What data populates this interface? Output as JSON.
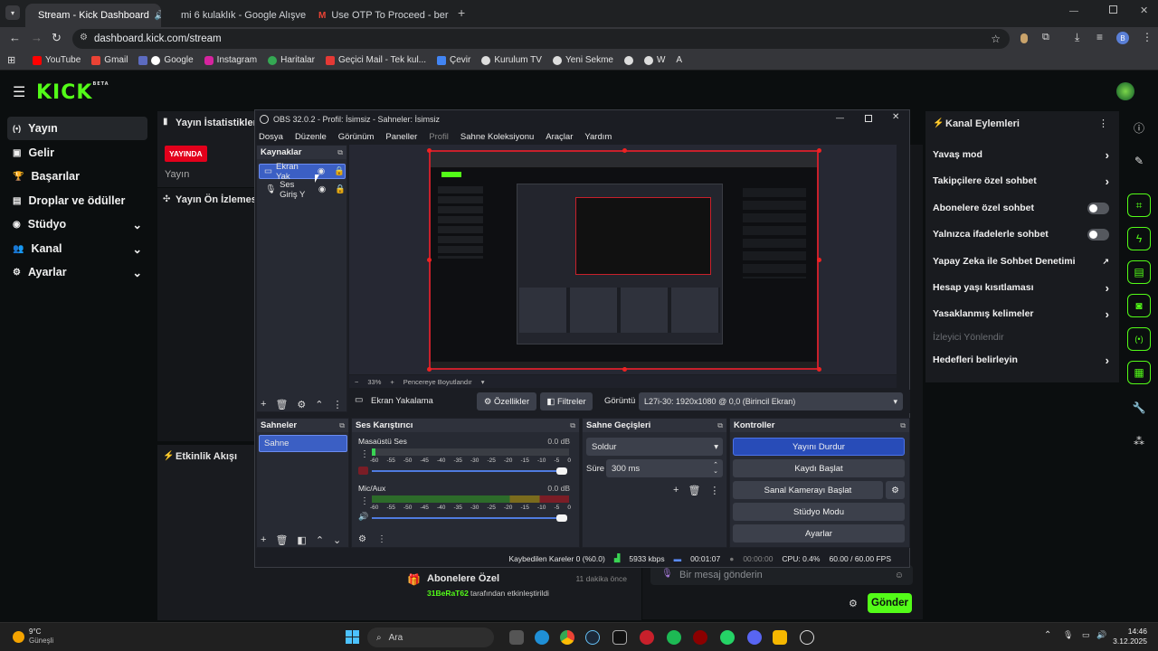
{
  "browser": {
    "tabs": [
      {
        "title": "Stream - Kick Dashboard",
        "active": true
      },
      {
        "title": "mi 6 kulaklık - Google Alışveriş",
        "active": false
      },
      {
        "title": "Use OTP To Proceed - beratery",
        "active": false
      }
    ],
    "url": "dashboard.kick.com/stream",
    "profile_initial": "B",
    "bookmarks": [
      "YouTube",
      "Gmail",
      "Google",
      "Instagram",
      "Haritalar",
      "Geçici Mail - Tek kul...",
      "Çevir",
      "Kurulum TV",
      "Yeni Sekme",
      "W",
      "A"
    ]
  },
  "kick": {
    "logo": "KICK",
    "logo_badge": "BETA",
    "sidebar": [
      {
        "label": "Yayın",
        "icon": "broadcast-icon",
        "expandable": false
      },
      {
        "label": "Gelir",
        "icon": "money-icon",
        "expandable": false
      },
      {
        "label": "Başarılar",
        "icon": "trophy-icon",
        "expandable": false
      },
      {
        "label": "Droplar ve ödüller",
        "icon": "gift-icon",
        "expandable": false
      },
      {
        "label": "Stüdyo",
        "icon": "studio-icon",
        "expandable": true
      },
      {
        "label": "Kanal",
        "icon": "channel-icon",
        "expandable": true
      },
      {
        "label": "Ayarlar",
        "icon": "gear-icon",
        "expandable": true
      }
    ],
    "stats_title": "Yayın İstatistikleri",
    "live_badge": "YAYINDA",
    "stats_sub": "Yayın",
    "preview_title": "Yayın Ön İzlemesi",
    "activity_title": "Etkinlik Akışı",
    "activity_item": {
      "title": "Abonelere Özel",
      "time": "11 dakika önce",
      "user": "31BeRaT62",
      "text": "tarafından etkinleştirildi"
    },
    "chat_placeholder": "Bir mesaj gönderin",
    "send_label": "Gönder",
    "channel_actions": {
      "title": "Kanal Eylemleri",
      "items": [
        {
          "label": "Yavaş mod",
          "control": "chevron"
        },
        {
          "label": "Takipçilere özel sohbet",
          "control": "chevron"
        },
        {
          "label": "Abonelere özel sohbet",
          "control": "toggle"
        },
        {
          "label": "Yalnızca ifadelerle sohbet",
          "control": "toggle"
        },
        {
          "label": "Yapay Zeka ile Sohbet Denetimi",
          "control": "external"
        },
        {
          "label": "Hesap yaşı kısıtlaması",
          "control": "chevron"
        },
        {
          "label": "Yasaklanmış kelimeler",
          "control": "chevron"
        },
        {
          "label": "İzleyici Yönlendir",
          "control": "disabled"
        },
        {
          "label": "Hedefleri belirleyin",
          "control": "chevron"
        }
      ]
    }
  },
  "obs": {
    "title": "OBS 32.0.2 - Profil: İsimsiz - Sahneler: İsimsiz",
    "menu": [
      "Dosya",
      "Düzenle",
      "Görünüm",
      "Paneller",
      "Profil",
      "Sahne Koleksiyonu",
      "Araçlar",
      "Yardım"
    ],
    "sources_title": "Kaynaklar",
    "sources": [
      "Ekran Yak",
      "Ses Giriş Y"
    ],
    "zoom": "33%",
    "fit_label": "Pencereye Boyutlandır",
    "source_name": "Ekran Yakalama",
    "props_label": "Özellikler",
    "filters_label": "Filtreler",
    "display_label": "Görüntü",
    "display_value": "L27i-30: 1920x1080 @ 0,0 (Birincil Ekran)",
    "scenes_title": "Sahneler",
    "scenes": [
      "Sahne"
    ],
    "mixer_title": "Ses Karıştırıcı",
    "mixer_channels": [
      {
        "name": "Masaüstü Ses",
        "db": "0.0 dB"
      },
      {
        "name": "Mic/Aux",
        "db": "0.0 dB"
      }
    ],
    "mixer_scale": [
      "-60",
      "-55",
      "-50",
      "-45",
      "-40",
      "-35",
      "-30",
      "-25",
      "-20",
      "-15",
      "-10",
      "-5",
      "0"
    ],
    "transitions_title": "Sahne Geçişleri",
    "transition": "Soldur",
    "duration_label": "Süre",
    "duration": "300 ms",
    "controls_title": "Kontroller",
    "controls": [
      "Yayını Durdur",
      "Kaydı Başlat",
      "Sanal Kamerayı Başlat",
      "Stüdyo Modu",
      "Ayarlar"
    ],
    "status": {
      "dropped": "Kaybedilen Kareler 0 (%0.0)",
      "bitrate": "5933 kbps",
      "stream_time": "00:01:07",
      "rec_time": "00:00:00",
      "cpu": "CPU: 0.4%",
      "fps": "60.00 / 60.00 FPS"
    }
  },
  "taskbar": {
    "weather_temp": "9°C",
    "weather_text": "Güneşli",
    "search": "Ara",
    "time": "14:46",
    "date": "3.12.2025"
  }
}
